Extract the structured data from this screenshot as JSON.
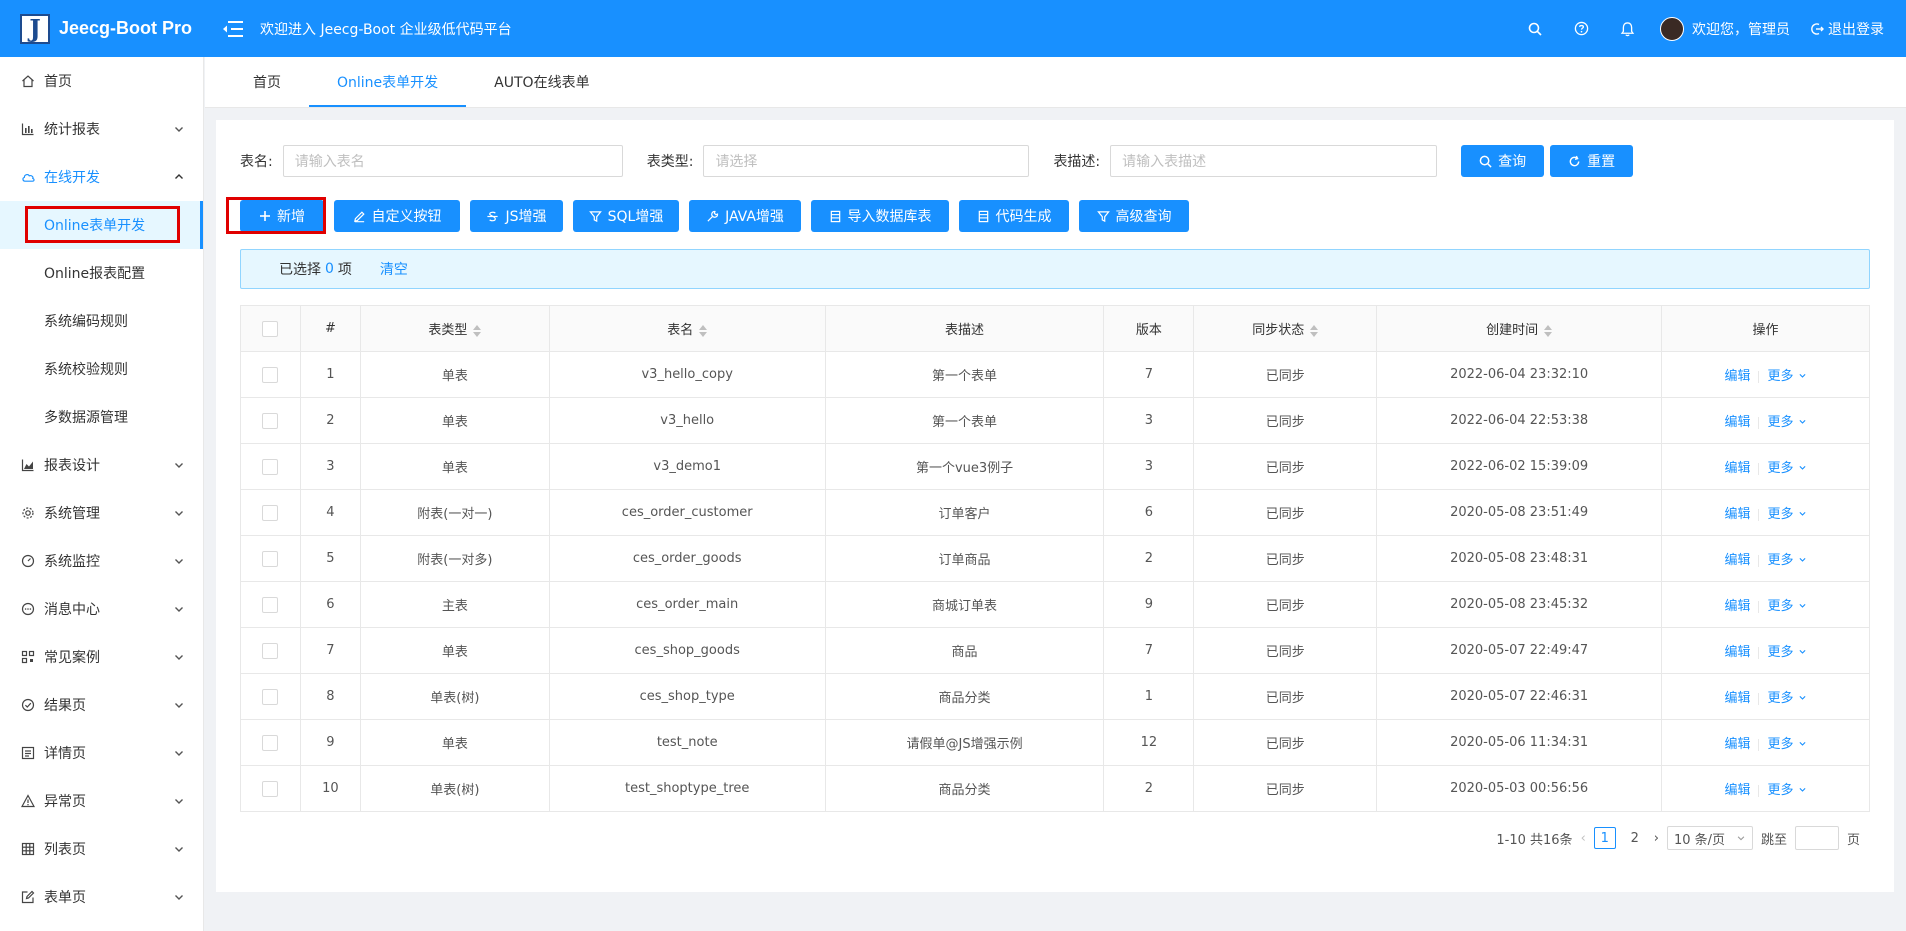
{
  "app": {
    "logo_letter": "J",
    "logo_text": "Jeecg-Boot Pro",
    "header_title": "欢迎进入 Jeecg-Boot 企业级低代码平台",
    "user_greeting": "欢迎您，管理员",
    "logout_label": "退出登录",
    "colors": {
      "primary": "#1890ff",
      "success": "#52c41a",
      "highlight": "#e00000"
    }
  },
  "sidebar": {
    "items": [
      {
        "label": "首页",
        "icon": "home-icon"
      },
      {
        "label": "统计报表",
        "icon": "bar-chart-icon"
      },
      {
        "label": "在线开发",
        "icon": "cloud-icon"
      },
      {
        "label": "报表设计",
        "icon": "area-chart-icon"
      },
      {
        "label": "系统管理",
        "icon": "gear-icon"
      },
      {
        "label": "系统监控",
        "icon": "dashboard-icon"
      },
      {
        "label": "消息中心",
        "icon": "message-icon"
      },
      {
        "label": "常见案例",
        "icon": "qrcode-icon"
      },
      {
        "label": "结果页",
        "icon": "check-circle-icon"
      },
      {
        "label": "详情页",
        "icon": "profile-icon"
      },
      {
        "label": "异常页",
        "icon": "warning-icon"
      },
      {
        "label": "列表页",
        "icon": "table-icon"
      },
      {
        "label": "表单页",
        "icon": "form-icon"
      }
    ],
    "sub_items": [
      "Online表单开发",
      "Online报表配置",
      "系统编码规则",
      "系统校验规则",
      "多数据源管理"
    ]
  },
  "tabs": [
    "首页",
    "Online表单开发",
    "AUTO在线表单"
  ],
  "search": {
    "table_name_label": "表名:",
    "table_name_placeholder": "请输入表名",
    "table_type_label": "表类型:",
    "table_type_placeholder": "请选择",
    "table_desc_label": "表描述:",
    "table_desc_placeholder": "请输入表描述",
    "query_label": "查询",
    "reset_label": "重置"
  },
  "toolbar": [
    "新增",
    "自定义按钮",
    "JS增强",
    "SQL增强",
    "JAVA增强",
    "导入数据库表",
    "代码生成",
    "高级查询"
  ],
  "selection": {
    "prefix": "已选择",
    "count": "0",
    "suffix": "项",
    "clear": "清空"
  },
  "table": {
    "columns": [
      "#",
      "表类型",
      "表名",
      "表描述",
      "版本",
      "同步状态",
      "创建时间",
      "操作"
    ],
    "edit_label": "编辑",
    "more_label": "更多",
    "rows": [
      {
        "idx": "1",
        "type": "单表",
        "name": "v3_hello_copy",
        "desc": "第一个表单",
        "version": "7",
        "sync": "已同步",
        "created": "2022-06-04 23:32:10"
      },
      {
        "idx": "2",
        "type": "单表",
        "name": "v3_hello",
        "desc": "第一个表单",
        "version": "3",
        "sync": "已同步",
        "created": "2022-06-04 22:53:38"
      },
      {
        "idx": "3",
        "type": "单表",
        "name": "v3_demo1",
        "desc": "第一个vue3例子",
        "version": "3",
        "sync": "已同步",
        "created": "2022-06-02 15:39:09"
      },
      {
        "idx": "4",
        "type": "附表(一对一)",
        "name": "ces_order_customer",
        "desc": "订单客户",
        "version": "6",
        "sync": "已同步",
        "created": "2020-05-08 23:51:49"
      },
      {
        "idx": "5",
        "type": "附表(一对多)",
        "name": "ces_order_goods",
        "desc": "订单商品",
        "version": "2",
        "sync": "已同步",
        "created": "2020-05-08 23:48:31"
      },
      {
        "idx": "6",
        "type": "主表",
        "name": "ces_order_main",
        "desc": "商城订单表",
        "version": "9",
        "sync": "已同步",
        "created": "2020-05-08 23:45:32"
      },
      {
        "idx": "7",
        "type": "单表",
        "name": "ces_shop_goods",
        "desc": "商品",
        "version": "7",
        "sync": "已同步",
        "created": "2020-05-07 22:49:47"
      },
      {
        "idx": "8",
        "type": "单表(树)",
        "name": "ces_shop_type",
        "desc": "商品分类",
        "version": "1",
        "sync": "已同步",
        "created": "2020-05-07 22:46:31"
      },
      {
        "idx": "9",
        "type": "单表",
        "name": "test_note",
        "desc": "请假单@JS增强示例",
        "version": "12",
        "sync": "已同步",
        "created": "2020-05-06 11:34:31"
      },
      {
        "idx": "10",
        "type": "单表(树)",
        "name": "test_shoptype_tree",
        "desc": "商品分类",
        "version": "2",
        "sync": "已同步",
        "created": "2020-05-03 00:56:56"
      }
    ]
  },
  "pagination": {
    "total": "1-10 共16条",
    "page1": "1",
    "page2": "2",
    "page_size": "10 条/页",
    "jump_label": "跳至",
    "page_suffix": "页"
  }
}
